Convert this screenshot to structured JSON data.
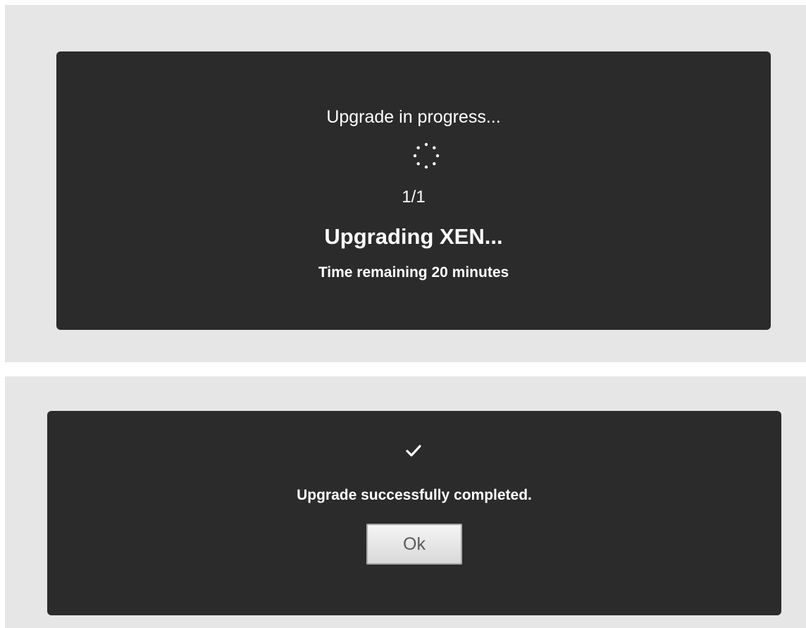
{
  "progress_dialog": {
    "status": "Upgrade in progress...",
    "spinner_icon": "loading-spinner-icon",
    "counter": "1/1",
    "task": "Upgrading XEN...",
    "time_remaining": "Time remaining 20 minutes"
  },
  "success_dialog": {
    "check_icon": "checkmark-icon",
    "message": "Upgrade successfully completed.",
    "ok_label": "Ok"
  },
  "colors": {
    "background": "#e6e6e6",
    "panel": "#2b2b2b",
    "text": "#ffffff",
    "button_text": "#5a5a5a"
  }
}
